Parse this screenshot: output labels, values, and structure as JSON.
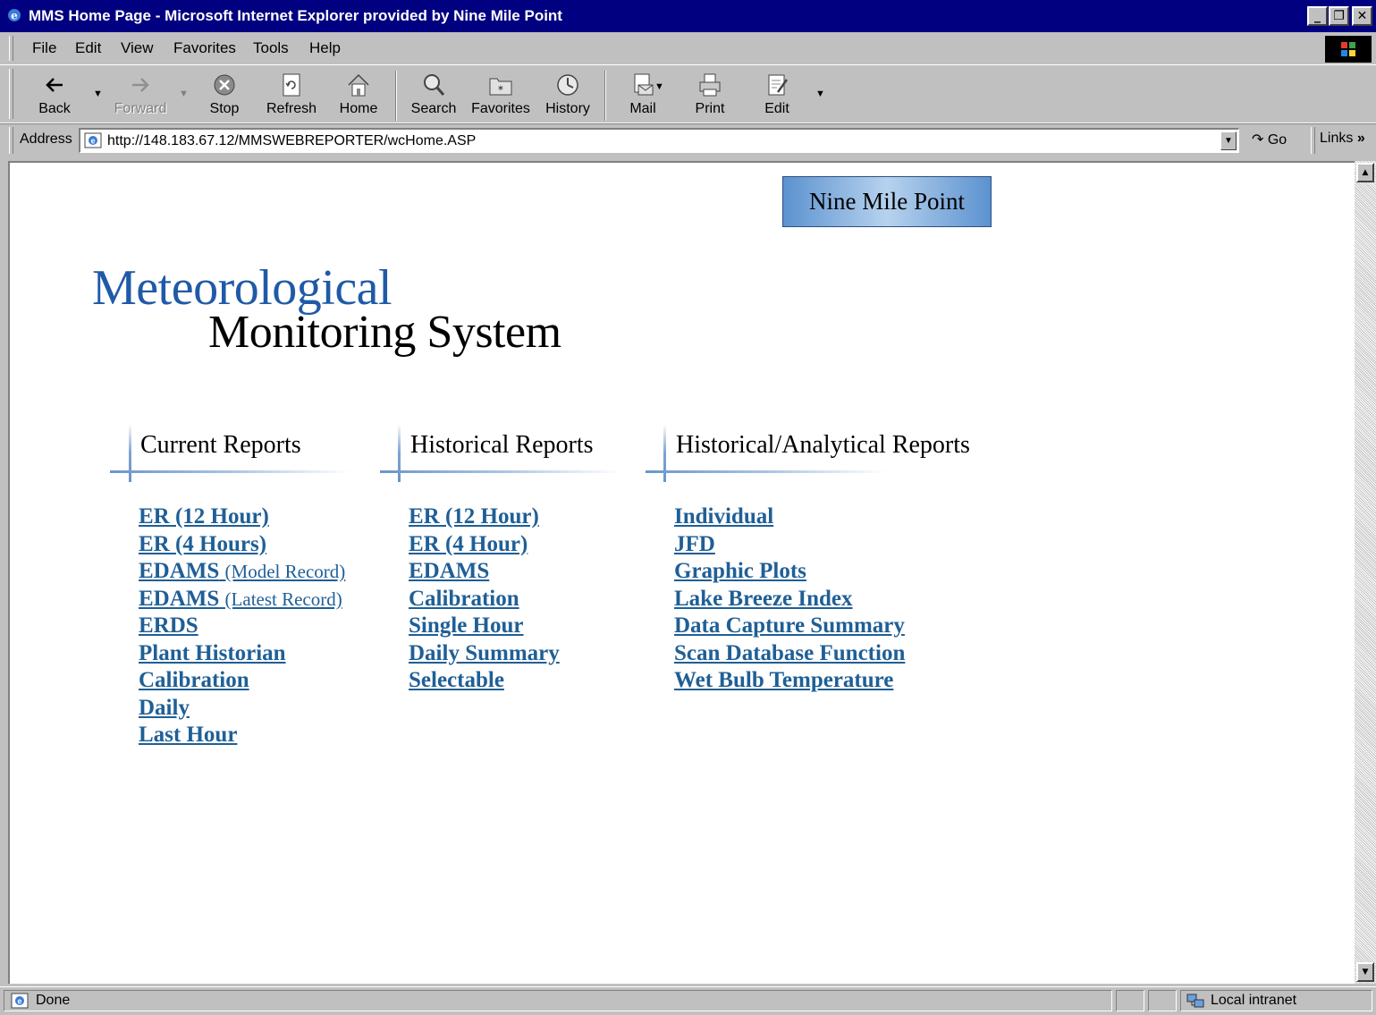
{
  "window": {
    "title": "MMS Home Page - Microsoft Internet Explorer provided by Nine Mile Point"
  },
  "menu": [
    "File",
    "Edit",
    "View",
    "Favorites",
    "Tools",
    "Help"
  ],
  "toolbar": {
    "back": "Back",
    "forward": "Forward",
    "stop": "Stop",
    "refresh": "Refresh",
    "home": "Home",
    "search": "Search",
    "favorites": "Favorites",
    "history": "History",
    "mail": "Mail",
    "print": "Print",
    "edit": "Edit"
  },
  "address": {
    "label": "Address",
    "url": "http://148.183.67.12/MMSWEBREPORTER/wcHome.ASP",
    "go": "Go",
    "links": "Links"
  },
  "page": {
    "brand_button": "Nine Mile Point",
    "logo_line1": "Meteorological",
    "logo_line2": "Monitoring System",
    "columns": [
      {
        "heading": "Current Reports",
        "links": [
          {
            "text": "ER (12 Hour)",
            "sub": ""
          },
          {
            "text": "ER (4 Hours)",
            "sub": ""
          },
          {
            "text": "EDAMS",
            "sub": "(Model Record)"
          },
          {
            "text": "EDAMS",
            "sub": "(Latest Record)"
          },
          {
            "text": "ERDS",
            "sub": ""
          },
          {
            "text": "Plant Historian",
            "sub": ""
          },
          {
            "text": "Calibration",
            "sub": ""
          },
          {
            "text": "Daily",
            "sub": ""
          },
          {
            "text": "Last Hour",
            "sub": ""
          }
        ]
      },
      {
        "heading": "Historical Reports",
        "links": [
          {
            "text": "ER (12 Hour)",
            "sub": ""
          },
          {
            "text": "ER (4 Hour)",
            "sub": ""
          },
          {
            "text": "EDAMS",
            "sub": ""
          },
          {
            "text": "Calibration",
            "sub": ""
          },
          {
            "text": "Single Hour",
            "sub": ""
          },
          {
            "text": "Daily Summary",
            "sub": ""
          },
          {
            "text": "Selectable",
            "sub": ""
          }
        ]
      },
      {
        "heading": "Historical/Analytical Reports",
        "links": [
          {
            "text": "Individual",
            "sub": ""
          },
          {
            "text": "JFD",
            "sub": ""
          },
          {
            "text": "Graphic Plots",
            "sub": ""
          },
          {
            "text": "Lake Breeze Index",
            "sub": ""
          },
          {
            "text": "Data Capture Summary",
            "sub": ""
          },
          {
            "text": "Scan Database Function",
            "sub": ""
          },
          {
            "text": "Wet Bulb Temperature",
            "sub": ""
          }
        ]
      }
    ]
  },
  "status": {
    "text": "Done",
    "zone": "Local intranet"
  },
  "colors": {
    "titlebar": "#000080",
    "link": "#1f5f96",
    "logo_blue": "#1f5aa8",
    "brand_box": "#5b92cf"
  }
}
